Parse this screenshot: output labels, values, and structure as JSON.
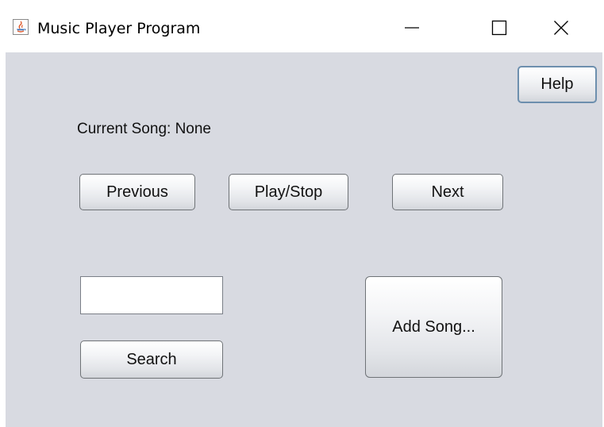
{
  "window": {
    "title": "Music Player Program",
    "icon": "java-icon",
    "controls": {
      "minimize": "minimize-icon",
      "maximize": "maximize-icon",
      "close": "close-icon"
    }
  },
  "help": {
    "label": "Help"
  },
  "current_song": {
    "label": "Current Song:",
    "value": "None"
  },
  "playback": {
    "previous_label": "Previous",
    "play_stop_label": "Play/Stop",
    "next_label": "Next"
  },
  "search": {
    "value": "",
    "placeholder": "",
    "button_label": "Search"
  },
  "add_song": {
    "label": "Add Song..."
  },
  "colors": {
    "panel_bg": "#d8dae1",
    "focus_border": "#6d8fae",
    "button_border": "#6f7377"
  }
}
